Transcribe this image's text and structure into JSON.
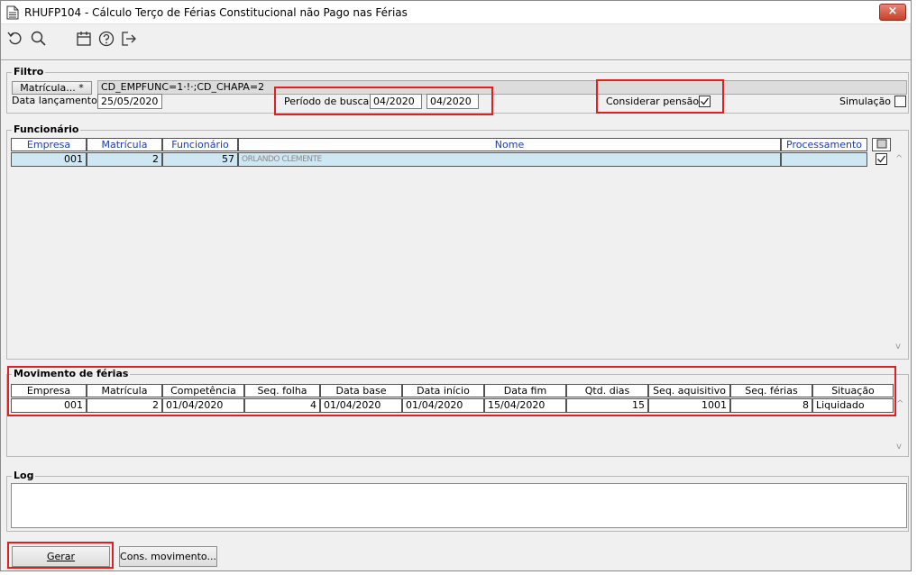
{
  "window": {
    "title": "RHUFP104 - Cálculo Terço de Férias Constitucional não Pago nas Férias",
    "close_glyph": "×"
  },
  "toolbar": {
    "icons": [
      "refresh-icon",
      "search-icon",
      "calendar-icon",
      "help-icon",
      "exit-icon"
    ]
  },
  "filtro": {
    "title": "Filtro",
    "matricula_button": "Matrícula... *",
    "matricula_value": "CD_EMPFUNC=1·!·;CD_CHAPA=2",
    "data_lancamento_label": "Data lançamento",
    "data_lancamento_value": "25/05/2020",
    "periodo_label": "Período de busca",
    "periodo_inicio": "04/2020",
    "periodo_fim": "04/2020",
    "considerar_pensao_label": "Considerar pensão",
    "considerar_pensao_checked": true,
    "simulacao_label": "Simulação",
    "simulacao_checked": false
  },
  "funcionario": {
    "title": "Funcionário",
    "columns": [
      "Empresa",
      "Matrícula",
      "Funcionário",
      "Nome",
      "Processamento"
    ],
    "rows": [
      {
        "empresa": "001",
        "matricula": "2",
        "funcionario": "57",
        "nome": "ORLANDO CLEMENTE",
        "processamento": "",
        "checked": true
      }
    ]
  },
  "movimento": {
    "title": "Movimento de férias",
    "columns": [
      "Empresa",
      "Matrícula",
      "Competência",
      "Seq. folha",
      "Data base",
      "Data início",
      "Data fim",
      "Qtd. dias",
      "Seq. aquisitivo",
      "Seq. férias",
      "Situação"
    ],
    "rows": [
      {
        "empresa": "001",
        "matricula": "2",
        "competencia": "01/04/2020",
        "seq_folha": "4",
        "data_base": "01/04/2020",
        "data_inicio": "01/04/2020",
        "data_fim": "15/04/2020",
        "qtd_dias": "15",
        "seq_aquisitivo": "1001",
        "seq_ferias": "8",
        "situacao": "Liquidado"
      }
    ]
  },
  "log": {
    "title": "Log",
    "content": ""
  },
  "buttons": {
    "gerar": "Gerar",
    "cons_movimento": "Cons. movimento..."
  },
  "colors": {
    "highlight": "#e02020",
    "selected_row": "#cde8f3",
    "header_text": "#1a3ea8"
  }
}
